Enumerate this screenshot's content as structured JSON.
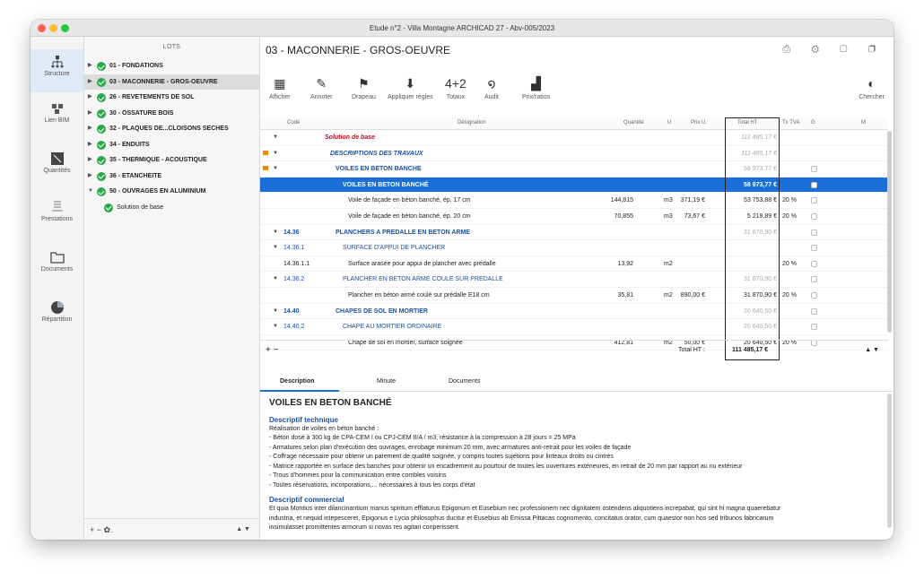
{
  "window": {
    "title": "Etude n°2 - Villa Montagne ARCHICAD 27 - Abv-005/2023"
  },
  "nav": [
    {
      "label": "Structure",
      "icon": "structure-icon"
    },
    {
      "label": "Lien BIM",
      "icon": "bim-link-icon"
    },
    {
      "label": "Quantités",
      "icon": "quantities-icon"
    },
    {
      "label": "Prestations",
      "icon": "prestations-icon"
    },
    {
      "label": "Documents",
      "icon": "documents-icon"
    },
    {
      "label": "Répartition",
      "icon": "pie-icon"
    }
  ],
  "lots": {
    "header": "LOTS",
    "items": [
      "01 - FONDATIONS",
      "03 - MACONNERIE - GROS-OEUVRE",
      "26 - REVETEMENTS DE SOL",
      "30 - OSSATURE BOIS",
      "32 - PLAQUES DE...CLOISONS SECHES",
      "34 - ENDUITS",
      "35 - THERMIQUE - ACOUSTIQUE",
      "36 - ETANCHEITE",
      "50 - OUVRAGES EN ALUMINIUM"
    ],
    "sub": "Solution de base",
    "footer": "+  −  ✿."
  },
  "main": {
    "title": "03 - MACONNERIE - GROS-OEUVRE"
  },
  "toolbar": {
    "afficher": "Afficher",
    "annoter": "Annoter",
    "drapeau": "Drapeau",
    "appliquer": "Appliquer règles",
    "totaux": "Totaux",
    "totaux_val": "4+2",
    "audit": "Audit",
    "prix": "Prix/ratios",
    "chercher": "Chercher"
  },
  "cols": {
    "code": "Code",
    "designation": "Désignation",
    "quantite": "Quantité",
    "u": "U",
    "prix": "Prix U.",
    "total": "Total HT",
    "tva": "Tx TVA",
    "g": "G",
    "m": "M"
  },
  "rows": [
    {
      "code": "",
      "des": "Solution de base",
      "q": "",
      "u": "",
      "p": "",
      "t": "111 485,17 €",
      "v": ""
    },
    {
      "code": "",
      "des": "DESCRIPTIONS DES TRAVAUX",
      "q": "",
      "u": "",
      "p": "",
      "t": "111 485,17 €",
      "v": ""
    },
    {
      "code": "",
      "des": "VOILES EN BETON BANCHE",
      "q": "",
      "u": "",
      "p": "",
      "t": "58 973,77 €",
      "v": ""
    },
    {
      "code": "",
      "des": "VOILES EN BETON BANCHÉ",
      "q": "",
      "u": "",
      "p": "",
      "t": "58 973,77 €",
      "v": ""
    },
    {
      "code": "",
      "des": "Voile de façade en béton banché, ép. 17 cm",
      "q": "144,815",
      "u": "m3",
      "p": "371,19 €",
      "t": "53 753,88 €",
      "v": "20 %"
    },
    {
      "code": "",
      "des": "Voile de façade en béton banché, ép. 20 cm",
      "q": "70,855",
      "u": "m3",
      "p": "73,67 €",
      "t": "5 219,89 €",
      "v": "20 %"
    },
    {
      "code": "14.36",
      "des": "PLANCHERS A PREDALLE EN BETON ARME",
      "q": "",
      "u": "",
      "p": "",
      "t": "31 870,90 €",
      "v": ""
    },
    {
      "code": "14.36.1",
      "des": "SURFACE D'APPUI DE PLANCHER",
      "q": "",
      "u": "",
      "p": "",
      "t": "",
      "v": ""
    },
    {
      "code": "14.36.1.1",
      "des": "Surface arasée pour appui de plancher avec prédalle",
      "q": "13,92",
      "u": "m2",
      "p": "",
      "t": "",
      "v": "20 %"
    },
    {
      "code": "14.36.2",
      "des": "PLANCHER EN BETON ARME COULE SUR PREDALLE",
      "q": "",
      "u": "",
      "p": "",
      "t": "31 870,90 €",
      "v": ""
    },
    {
      "code": "",
      "des": "Plancher en béton armé coulé sur prédalle E18 cm",
      "q": "35,81",
      "u": "m2",
      "p": "890,00 €",
      "t": "31 870,90 €",
      "v": "20 %"
    },
    {
      "code": "14.40",
      "des": "CHAPES DE SOL EN MORTIER",
      "q": "",
      "u": "",
      "p": "",
      "t": "20 640,50 €",
      "v": ""
    },
    {
      "code": "14.40.2",
      "des": "CHAPE AU MORTIER ORDINAIRE",
      "q": "",
      "u": "",
      "p": "",
      "t": "20 640,50 €",
      "v": ""
    },
    {
      "code": "",
      "des": "Chape de sol en mortier, surface soignée",
      "q": "412,81",
      "u": "m2",
      "p": "50,00 €",
      "t": "20 640,50 €",
      "v": "20 %"
    }
  ],
  "footer": {
    "total_label": "Total HT :",
    "total_value": "111 485,17 €"
  },
  "tabs": [
    "Description",
    "Minute",
    "Documents"
  ],
  "desc": {
    "title": "VOILES EN BETON BANCHÉ",
    "h1": "Descriptif technique",
    "lines": [
      "Réalisation de voiles en béton banché :",
      "- Béton dosé à 300 kg de CPA-CEM I ou CPJ-CEM II/A / m3, résistance à la compression à 28 jours = 25 MPa",
      "- Armatures selon plan d'exécution des ouvrages, enrobage minimum 20 mm, avec armatures anti-retrait pour les voiles de façade",
      "- Coffrage nécessaire pour obtenir un parement de qualité soignée, y compris toutes sujétions pour linteaux droits ou cintrés",
      "- Matrice rapportée en surface des banches pour obtenir un encadrement au pourtour de toutes les ouvertures extérieures, en retrait de 20 mm par rapport au nu extérieur",
      "- Trous d'hommes pour la communication entre combles voisins",
      "- Toutes réservations, incorporations,... nécessaires à tous les corps d'état"
    ],
    "h2": "Descriptif commercial",
    "comm": [
      "Et quia Montius inter dilancinantium manus spiritum efflaturus Epigonum et Eusebium nec professionem nec dignitatem ostendens aliquotiens increpabat, qui sint hi magna quaerebatur",
      "industria, et nequid intepesceret, Epigonus e Lycia philosophus ducitur et Eusebius ab Emissa Pittacas cognomento, concitatus orator, cum quaestor non hos sed tribunos fabricarum",
      "insimulasset promittentes armorum si novas res agitari conperissent."
    ]
  }
}
